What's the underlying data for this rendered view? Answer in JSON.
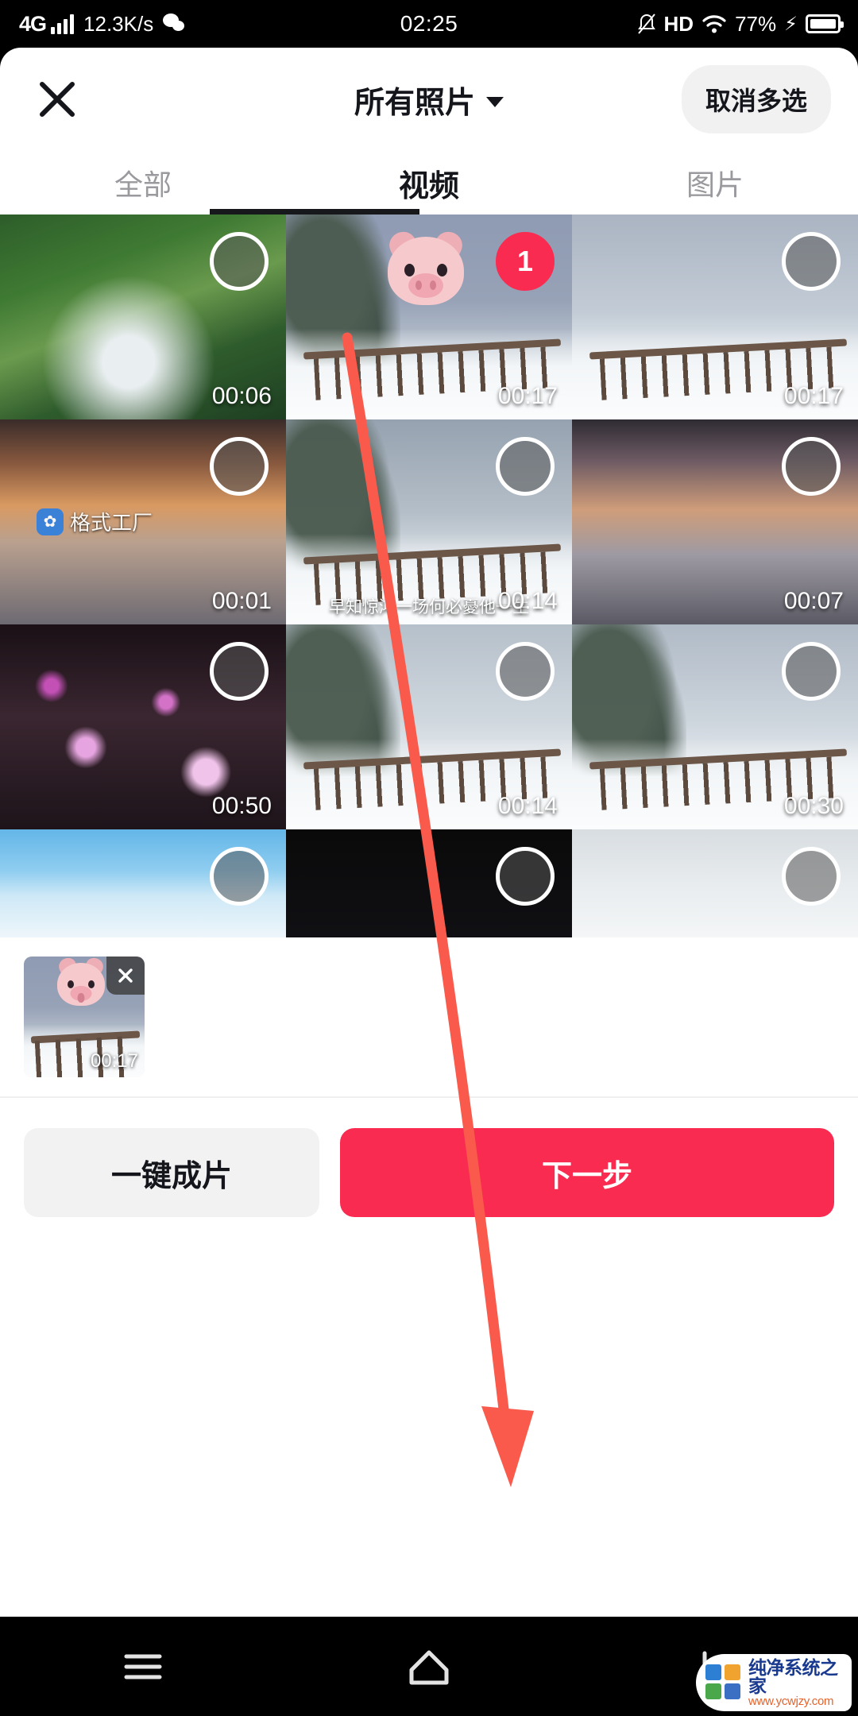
{
  "status_bar": {
    "network_type": "4G",
    "data_speed": "12.3K/s",
    "time": "02:25",
    "hd_label": "HD",
    "battery_percent": "77%",
    "icons": [
      "signal-bars-icon",
      "wechat-icon",
      "mute-icon",
      "hd-icon",
      "wifi-icon",
      "charging-bolt-icon",
      "battery-icon"
    ]
  },
  "header": {
    "close_label": "✕",
    "title": "所有照片",
    "multiselect_button": "取消多选"
  },
  "tabs": [
    {
      "label": "全部",
      "active": false
    },
    {
      "label": "视频",
      "active": true
    },
    {
      "label": "图片",
      "active": false
    }
  ],
  "grid": {
    "items": [
      {
        "duration": "00:06",
        "selected": false,
        "art": "a-waterfall",
        "desc": "waterfall-forest"
      },
      {
        "duration": "00:17",
        "selected": true,
        "badge": "1",
        "art": "a-snowdusk",
        "desc": "snow-dusk-pig-sticker"
      },
      {
        "duration": "00:17",
        "selected": false,
        "art": "a-snowfence",
        "desc": "snow-fence"
      },
      {
        "duration": "00:01",
        "selected": false,
        "art": "a-sunsetlake",
        "desc": "sunset-lake-watermark",
        "watermark": "格式工厂"
      },
      {
        "duration": "00:14",
        "selected": false,
        "art": "a-snowgrey",
        "desc": "snow-fence-subtitle",
        "subtitle": "早知惊鸿一场何必憂他一生"
      },
      {
        "duration": "00:07",
        "selected": false,
        "art": "a-sunsetlake2",
        "desc": "sunset-lake-2"
      },
      {
        "duration": "00:50",
        "selected": false,
        "art": "a-blossom",
        "desc": "night-blossom"
      },
      {
        "duration": "00:14",
        "selected": false,
        "art": "a-snowfence2",
        "desc": "snow-fence-3"
      },
      {
        "duration": "00:30",
        "selected": false,
        "art": "a-snowfence3",
        "desc": "snow-fence-4"
      },
      {
        "duration": "",
        "selected": false,
        "art": "a-birds",
        "desc": "winter-birds"
      },
      {
        "duration": "",
        "selected": false,
        "art": "a-darkrow",
        "desc": "dark-clip"
      },
      {
        "duration": "",
        "selected": false,
        "art": "a-fog",
        "desc": "foggy-sky"
      }
    ]
  },
  "tray": {
    "items": [
      {
        "duration": "00:17",
        "remove_label": "✕",
        "art": "a-snowdusk"
      }
    ]
  },
  "actions": {
    "secondary_label": "一键成片",
    "primary_label": "下一步",
    "primary_color": "#fa2b50"
  },
  "nav_bar": {
    "items": [
      "menu-icon",
      "home-icon",
      "back-icon"
    ]
  },
  "watermark": {
    "line1": "纯净系统之家",
    "line2": "www.ycwjzy.com"
  },
  "annotation": {
    "color": "#fa5a4b",
    "type": "arrow"
  }
}
